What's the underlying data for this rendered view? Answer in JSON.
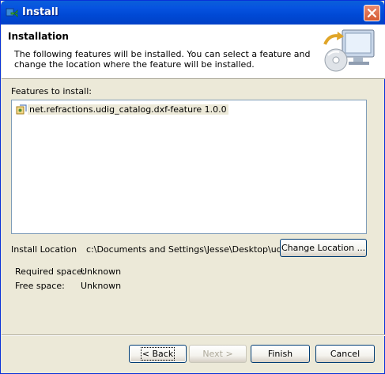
{
  "window": {
    "title": "Install",
    "icon": "install-wizard-icon",
    "close_icon": "close-icon"
  },
  "header": {
    "title": "Installation",
    "description": "The following features will be installed. You can select a feature and change the location where the feature will be installed.",
    "art_icon": "monitor-cd-install-icon"
  },
  "features": {
    "label": "Features to install:",
    "items": [
      {
        "label": "net.refractions.udig_catalog.dxf-feature 1.0.0",
        "icon": "feature-icon"
      }
    ]
  },
  "install_location": {
    "label": "Install Location",
    "value": "c:\\Documents and Settings\\Jesse\\Desktop\\udig",
    "change_button": "Change Location ..."
  },
  "space": {
    "required_label": "Required space:",
    "required_value": "Unknown",
    "free_label": "Free space:",
    "free_value": "Unknown"
  },
  "buttons": {
    "back": "< Back",
    "next": "Next >",
    "finish": "Finish",
    "cancel": "Cancel"
  },
  "colors": {
    "titlebar": "#0054e3",
    "dialog_bg": "#ece9d8",
    "close_button": "#d65a32"
  }
}
